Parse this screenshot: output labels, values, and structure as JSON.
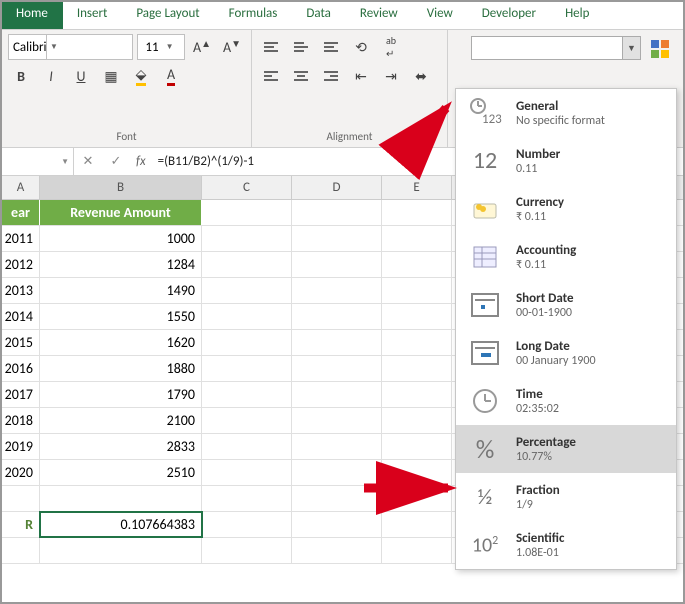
{
  "tabs": [
    "Home",
    "Insert",
    "Page Layout",
    "Formulas",
    "Data",
    "Review",
    "View",
    "Developer",
    "Help"
  ],
  "active_tab": "Home",
  "font": {
    "name": "Calibri",
    "size": "11",
    "group_label": "Font"
  },
  "align": {
    "group_label": "Alignment"
  },
  "formula_bar": {
    "cell_ref": "",
    "formula": "=(B11/B2)^(1/9)-1",
    "fx": "fx"
  },
  "columns": [
    "A",
    "B",
    "C",
    "D",
    "E"
  ],
  "header_row": {
    "col_a": "ear",
    "col_b": "Revenue Amount"
  },
  "data_rows": [
    {
      "year": "2011",
      "val": "1000"
    },
    {
      "year": "2012",
      "val": "1284"
    },
    {
      "year": "2013",
      "val": "1490"
    },
    {
      "year": "2014",
      "val": "1550"
    },
    {
      "year": "2015",
      "val": "1620"
    },
    {
      "year": "2016",
      "val": "1880"
    },
    {
      "year": "2017",
      "val": "1790"
    },
    {
      "year": "2018",
      "val": "2100"
    },
    {
      "year": "2019",
      "val": "2833"
    },
    {
      "year": "2020",
      "val": "2510"
    }
  ],
  "cagr_row": {
    "label": "R",
    "value": "0.107664383"
  },
  "number_formats": [
    {
      "key": "general",
      "title": "General",
      "sub": "No specific format"
    },
    {
      "key": "number",
      "title": "Number",
      "sub": "0.11"
    },
    {
      "key": "currency",
      "title": "Currency",
      "sub": "₹ 0.11"
    },
    {
      "key": "accounting",
      "title": "Accounting",
      "sub": "₹ 0.11"
    },
    {
      "key": "shortdate",
      "title": "Short Date",
      "sub": "00-01-1900"
    },
    {
      "key": "longdate",
      "title": "Long Date",
      "sub": "00 January 1900"
    },
    {
      "key": "time",
      "title": "Time",
      "sub": "02:35:02"
    },
    {
      "key": "percentage",
      "title": "Percentage",
      "sub": "10.77%"
    },
    {
      "key": "fraction",
      "title": "Fraction",
      "sub": "1/9"
    },
    {
      "key": "scientific",
      "title": "Scientific",
      "sub": "1.08E-01"
    }
  ],
  "chart_data": {
    "type": "table",
    "title": "Revenue Amount by Year",
    "columns": [
      "Year",
      "Revenue Amount"
    ],
    "rows": [
      [
        2011,
        1000
      ],
      [
        2012,
        1284
      ],
      [
        2013,
        1490
      ],
      [
        2014,
        1550
      ],
      [
        2015,
        1620
      ],
      [
        2016,
        1880
      ],
      [
        2017,
        1790
      ],
      [
        2018,
        2100
      ],
      [
        2019,
        2833
      ],
      [
        2020,
        2510
      ]
    ],
    "cagr": 0.107664383
  }
}
